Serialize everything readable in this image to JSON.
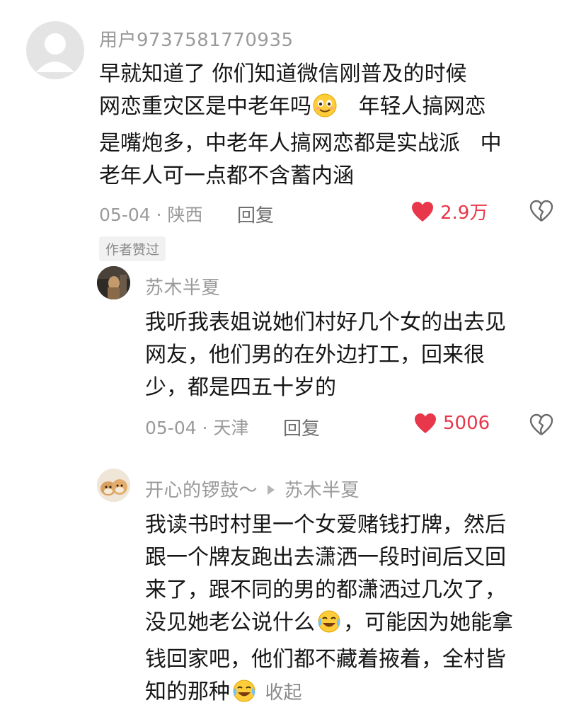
{
  "comments": [
    {
      "username": "用户9737581770935",
      "lines": [
        [
          "早就知道了 你们知道微信刚普及的时候"
        ],
        [
          "网恋重灾区是中老年吗",
          "[smile]",
          "   年轻人搞网恋"
        ],
        [
          "是嘴炮多，中老年人搞网恋都是实战派   中"
        ],
        [
          "老年人可一点都不含蓄内涵"
        ]
      ],
      "date_location": "05-04 · 陕西",
      "reply_label": "回复",
      "likes": "2.9万",
      "badge": "作者赞过"
    },
    {
      "username": "苏木半夏",
      "lines": [
        [
          "我听我表姐说她们村好几个女的出去见"
        ],
        [
          "网友，他们男的在外边打工，回来很"
        ],
        [
          "少，都是四五十岁的"
        ]
      ],
      "date_location": "05-04 · 天津",
      "reply_label": "回复",
      "likes": "5006"
    },
    {
      "username": "开心的锣鼓～",
      "reply_to": "苏木半夏",
      "lines": [
        [
          "我读书时村里一个女爱赌钱打牌，然后"
        ],
        [
          "跟一个牌友跑出去潇洒一段时间后又回"
        ],
        [
          "来了，跟不同的男的都潇洒过几次了，"
        ],
        [
          "没见她老公说什么",
          "[cry-laugh]",
          "，可能因为她能拿"
        ],
        [
          "钱回家吧，他们都不藏着掖着，全村皆"
        ],
        [
          "知的那种",
          "[cry-laugh]",
          " "
        ]
      ],
      "collapse_label": "收起"
    }
  ],
  "colors": {
    "like_red": "#e8374a",
    "meta_gray": "#9a9a9a"
  },
  "icons": [
    "heart-icon",
    "broken-heart-icon",
    "smile-emoji-icon",
    "cry-laugh-emoji-icon",
    "default-avatar-icon",
    "reply-arrow-icon"
  ]
}
